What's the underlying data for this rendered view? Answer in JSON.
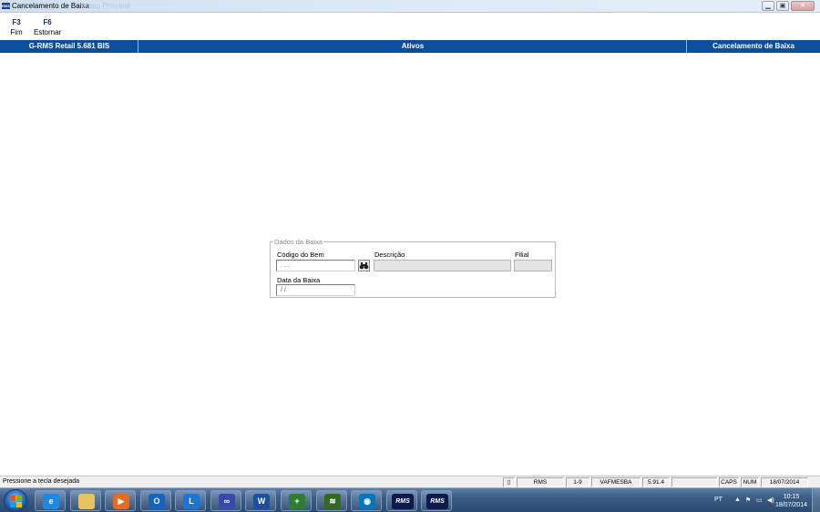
{
  "window": {
    "title": "Cancelamento de Baixa",
    "ghost_text": "Menu Principal",
    "app_icon_text": "RMS",
    "controls": [
      "minimize",
      "maximize",
      "close"
    ]
  },
  "function_keys": [
    {
      "key": "F3",
      "label": "Fim"
    },
    {
      "key": "F6",
      "label": "Estornar"
    }
  ],
  "header_band": {
    "left": "G-RMS Retail 5.681 BIS",
    "center": "Ativos",
    "right": "Cancelamento de Baixa"
  },
  "form": {
    "group_title": "Dados da Baixa",
    "codigo_label": "Código do Bem",
    "codigo_value": "  .   .   .  ",
    "descricao_label": "Descrição",
    "descricao_value": "",
    "filial_label": "Filial",
    "filial_value": "",
    "data_label": "Data da Baixa",
    "data_value": " / /",
    "lookup_icon": "binoculars-icon"
  },
  "status_bar": {
    "message": "Pressione a tecla desejada",
    "panels": [
      "RMS",
      "1-9",
      "VAFMESBA",
      "5.91.4",
      "",
      "CAPS",
      "NUM",
      "18/07/2014"
    ]
  },
  "taskbar": {
    "apps": [
      {
        "name": "internet-explorer",
        "glyph": "e",
        "color": "#1e88e5"
      },
      {
        "name": "file-explorer",
        "glyph": "",
        "color": "#e6c35c"
      },
      {
        "name": "media-player",
        "glyph": "▶",
        "color": "#e66a1f"
      },
      {
        "name": "outlook",
        "glyph": "O",
        "color": "#1565c0"
      },
      {
        "name": "lync",
        "glyph": "L",
        "color": "#1976d2"
      },
      {
        "name": "app-blue-circles",
        "glyph": "∞",
        "color": "#3949ab"
      },
      {
        "name": "word",
        "glyph": "W",
        "color": "#1e4fa3"
      },
      {
        "name": "app-green-plus",
        "glyph": "+",
        "color": "#2e7d32"
      },
      {
        "name": "app-green-stack",
        "glyph": "≋",
        "color": "#33691e"
      },
      {
        "name": "app-globe",
        "glyph": "◉",
        "color": "#0277bd"
      },
      {
        "name": "rms-1",
        "glyph": "RMS",
        "color": "#0d1b4a"
      },
      {
        "name": "rms-2",
        "glyph": "RMS",
        "color": "#0d1b4a"
      }
    ],
    "tray": {
      "language": "PT",
      "time": "10:15",
      "date": "18/07/2014"
    }
  }
}
